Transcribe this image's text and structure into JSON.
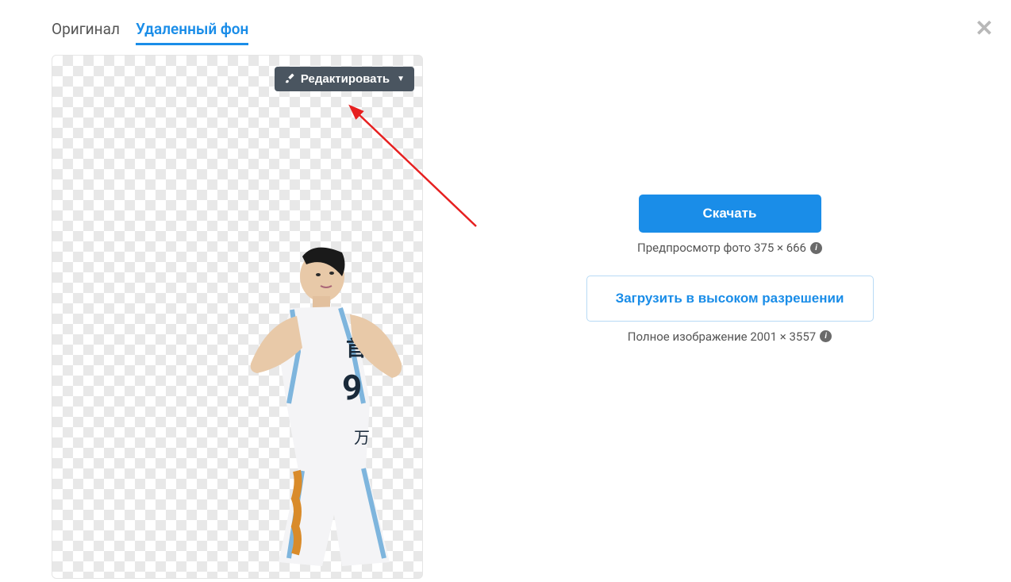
{
  "tabs": {
    "original": "Оригинал",
    "removed_bg": "Удаленный фон"
  },
  "edit_button": "Редактировать",
  "download": {
    "button": "Скачать",
    "preview_label": "Предпросмотр фото 375 × 666"
  },
  "high_quality": {
    "button": "Загрузить в высоком разрешении",
    "full_label": "Полное изображение 2001 × 3557"
  }
}
